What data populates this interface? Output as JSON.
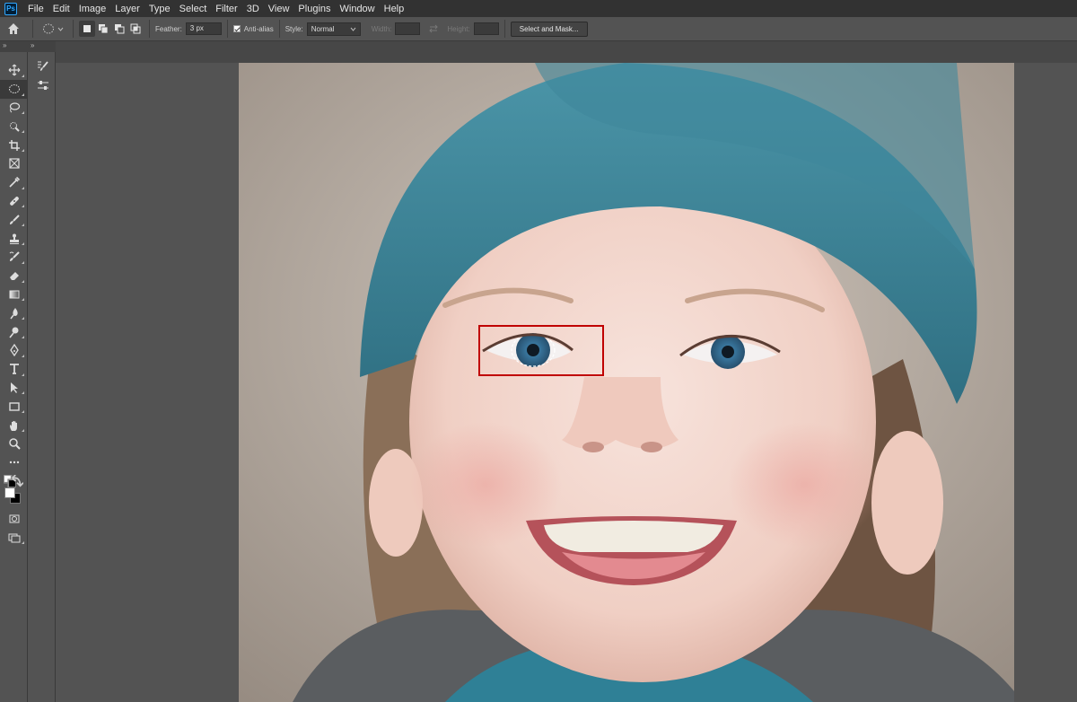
{
  "app": {
    "logo_text": "Ps"
  },
  "menu": [
    "File",
    "Edit",
    "Image",
    "Layer",
    "Type",
    "Select",
    "Filter",
    "3D",
    "View",
    "Plugins",
    "Window",
    "Help"
  ],
  "options": {
    "feather_label": "Feather:",
    "feather_value": "3 px",
    "antialias_label": "Anti-alias",
    "antialias_checked": true,
    "style_label": "Style:",
    "style_value": "Normal",
    "width_label": "Width:",
    "height_label": "Height:",
    "select_mask_label": "Select and Mask..."
  },
  "panels": {
    "collapse_glyph": "»"
  },
  "tools": [
    {
      "name": "move-tool",
      "icon": "move-icon",
      "active": false
    },
    {
      "name": "elliptical-marquee-tool",
      "icon": "ellipse-marquee-icon",
      "active": true
    },
    {
      "name": "lasso-tool",
      "icon": "lasso-icon",
      "active": false
    },
    {
      "name": "quick-selection-tool",
      "icon": "quick-selection-icon",
      "active": false
    },
    {
      "name": "crop-tool",
      "icon": "crop-icon",
      "active": false
    },
    {
      "name": "frame-tool",
      "icon": "frame-icon",
      "active": false
    },
    {
      "name": "eyedropper-tool",
      "icon": "eyedropper-icon",
      "active": false
    },
    {
      "name": "healing-brush-tool",
      "icon": "bandage-icon",
      "active": false
    },
    {
      "name": "brush-tool",
      "icon": "brush-icon",
      "active": false
    },
    {
      "name": "clone-stamp-tool",
      "icon": "stamp-icon",
      "active": false
    },
    {
      "name": "history-brush-tool",
      "icon": "history-brush-icon",
      "active": false
    },
    {
      "name": "eraser-tool",
      "icon": "eraser-icon",
      "active": false
    },
    {
      "name": "gradient-tool",
      "icon": "gradient-icon",
      "active": false
    },
    {
      "name": "blur-tool",
      "icon": "blur-drop-icon",
      "active": false
    },
    {
      "name": "dodge-tool",
      "icon": "dodge-icon",
      "active": false
    },
    {
      "name": "pen-tool",
      "icon": "pen-icon",
      "active": false
    },
    {
      "name": "type-tool",
      "icon": "type-icon",
      "active": false
    },
    {
      "name": "path-selection-tool",
      "icon": "arrow-icon",
      "active": false
    },
    {
      "name": "rectangle-tool",
      "icon": "rectangle-icon",
      "active": false
    },
    {
      "name": "hand-tool",
      "icon": "hand-icon",
      "active": false
    },
    {
      "name": "zoom-tool",
      "icon": "zoom-icon",
      "active": false
    },
    {
      "name": "edit-toolbar",
      "icon": "more-icon",
      "active": false
    }
  ],
  "colors": {
    "foreground": "#ffffff",
    "background": "#000000",
    "highlight_box": "#c00000",
    "ui_dark": "#323232",
    "ui_mid": "#535353"
  }
}
